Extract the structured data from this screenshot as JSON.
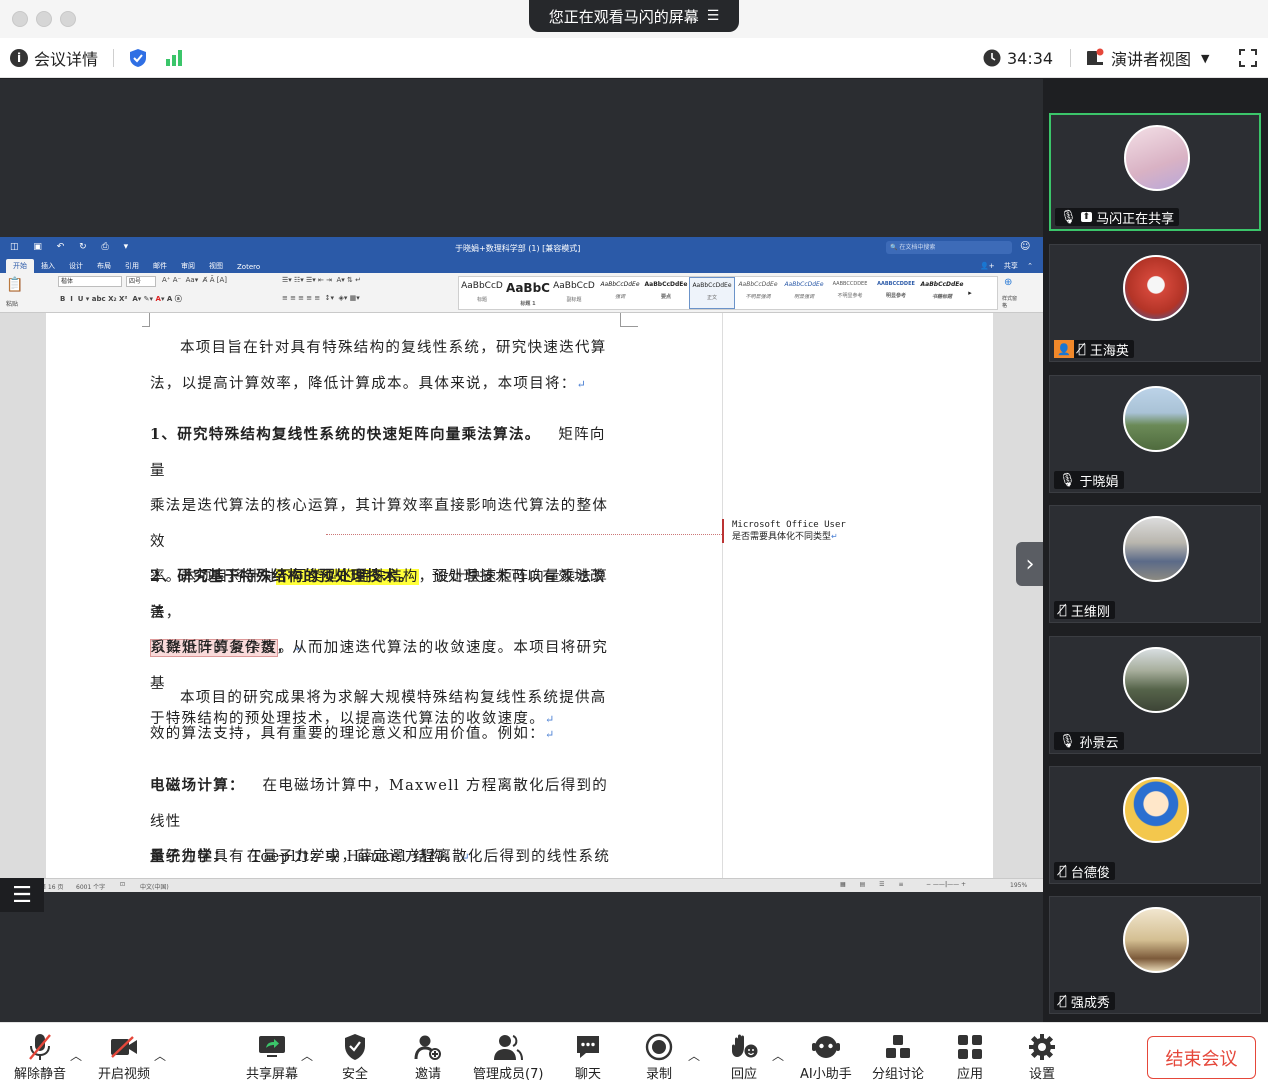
{
  "window": {
    "share_banner": "您正在观看马闪的屏幕"
  },
  "infobar": {
    "meeting_details": "会议详情",
    "timer": "34:34",
    "speaker_view": "演讲者视图"
  },
  "word": {
    "doc_title": "于晓娟+数理科学部 (1) [兼容模式]",
    "search_placeholder": "在文档中搜索",
    "share_label": "共享",
    "tabs": [
      "开始",
      "插入",
      "设计",
      "布局",
      "引用",
      "邮件",
      "审阅",
      "视图",
      "Zotero"
    ],
    "font_name": "楷体",
    "font_size": "四号",
    "paste_label": "粘贴",
    "styles": [
      {
        "sample": "AaBbCcD",
        "label": "标题"
      },
      {
        "sample": "AaBbC",
        "label": "标题 1"
      },
      {
        "sample": "AaBbCcD",
        "label": "副标题"
      },
      {
        "sample": "AaBbCcDdEe",
        "label": "强调"
      },
      {
        "sample": "AaBbCcDdEe",
        "label": "要点"
      },
      {
        "sample": "AaBbCcDdEe",
        "label": "正文"
      },
      {
        "sample": "AaBbCcDdEe",
        "label": "不明显强调"
      },
      {
        "sample": "AaBbCcDdEe",
        "label": "明显强调"
      },
      {
        "sample": "AABBCCDDEE",
        "label": "不明显参考"
      },
      {
        "sample": "AABBCCDDEE",
        "label": "明显参考"
      },
      {
        "sample": "AaBbCcDdEe",
        "label": "书籍标题"
      }
    ],
    "styles_pane": "样式窗格",
    "paragraphs": {
      "p1_a": "本项目旨在针对具有特殊结构的复线性系统，研究快速迭代算",
      "p1_b": "法，以提高计算效率，降低计算成本。具体来说，本项目将：",
      "p2_title": "1、研究特殊结构复线性系统的快速矩阵向量乘法算法。",
      "p2_a": "矩阵向量",
      "p2_b": "乘法是迭代算法的核心运算，其计算效率直接影响迭代算法的整体效",
      "p2_c_pre": "率。本项目将针对",
      "p2_c_hl": "不同类型的特殊结构",
      "p2_c_post": "，设计快速矩阵向量乘法算法，",
      "p2_d_hl": "以降低计算复杂度",
      "p2_d_post": "。",
      "p3_title": "2、研究基于特殊结构的预处理技术。",
      "p3_a": "预处理技术可以有效地改善",
      "p3_b": "系数矩阵的条件数，从而加速迭代算法的收敛速度。本项目将研究基",
      "p3_c": "于特殊结构的预处理技术，以提高迭代算法的收敛速度。",
      "p4_a": "本项目的研究成果将为求解大规模特殊结构复线性系统提供高",
      "p4_b": "效的算法支持，具有重要的理论意义和应用价值。例如：",
      "p5_title": "电磁场计算：",
      "p5_a": "在电磁场计算中，Maxwell 方程离散化后得到的线性",
      "p5_b": "系统往往具有 Toeplitz 或 Hankel 结构。",
      "p6_title": "量子力学：",
      "p6_a": "在量子力学中，薛定谔方程离散化后得到的线性系统往"
    },
    "comment_author": "Microsoft Office User",
    "comment_text": "是否需要具体化不同类型",
    "status": {
      "page": "第 16 页",
      "words": "6001 个字",
      "language": "中文(中国)",
      "zoom": "195%"
    }
  },
  "participants": [
    {
      "name": "马闪正在共享",
      "avatar_color": "#e8c9d6",
      "active": true,
      "mic": "on",
      "sharing": true
    },
    {
      "name": "王海英",
      "avatar_color": "#c84a3a",
      "active": false,
      "mic": "muted",
      "host": true
    },
    {
      "name": "于晓娟",
      "avatar_color": "#7f9a6b",
      "active": false,
      "mic": "on"
    },
    {
      "name": "王维刚",
      "avatar_color": "#9e9a90",
      "active": false,
      "mic": "muted"
    },
    {
      "name": "孙景云",
      "avatar_color": "#6f7a66",
      "active": false,
      "mic": "on"
    },
    {
      "name": "台德俊",
      "avatar_color": "#f0c64a",
      "active": false,
      "mic": "muted"
    },
    {
      "name": "强成秀",
      "avatar_color": "#c9b48a",
      "active": false,
      "mic": "muted"
    }
  ],
  "toolbar": {
    "unmute": "解除静音",
    "video": "开启视频",
    "share": "共享屏幕",
    "security": "安全",
    "invite": "邀请",
    "members": "管理成员(7)",
    "chat": "聊天",
    "record": "录制",
    "react": "回应",
    "ai": "AI小助手",
    "breakout": "分组讨论",
    "apps": "应用",
    "settings": "设置",
    "end": "结束会议"
  },
  "colors": {
    "accent_green": "#3bc56a",
    "end_red": "#e5473a",
    "word_blue": "#2b5aa8"
  }
}
